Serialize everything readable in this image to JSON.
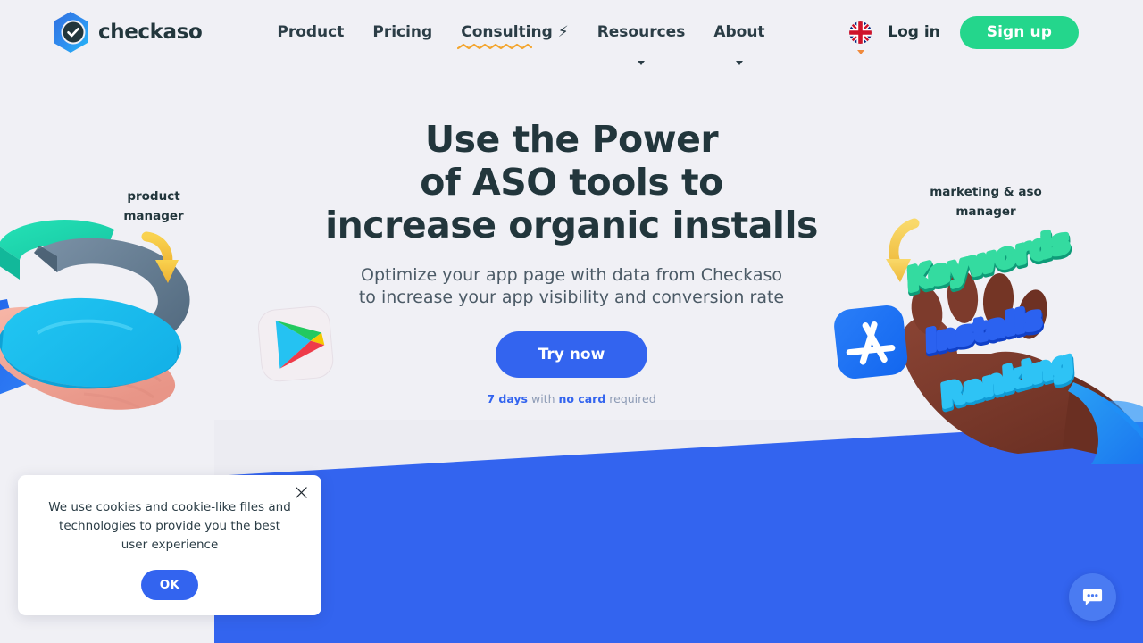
{
  "brand": {
    "name": "checkaso",
    "logo_icon": "checkaso-hexagon-check-logo",
    "accent_blue": "#3364ef",
    "accent_green": "#24d68c",
    "page_bg": "#f0f0f5",
    "heading_color": "#22363c"
  },
  "nav": {
    "items": [
      {
        "label": "Product",
        "icon": "",
        "has_caret": false,
        "active": false
      },
      {
        "label": "Pricing",
        "icon": "",
        "has_caret": false,
        "active": false
      },
      {
        "label": "Consulting",
        "icon": "lightning-bolt-icon",
        "bolt": "⚡",
        "has_caret": false,
        "active": true
      },
      {
        "label": "Resources",
        "icon": "chevron-down-icon",
        "has_caret": true,
        "active": false
      },
      {
        "label": "About",
        "icon": "chevron-down-icon",
        "has_caret": true,
        "active": false
      }
    ],
    "underline_color": "#f3a52e"
  },
  "header_right": {
    "language_icon": "uk-flag-icon",
    "language_caret_color": "#f08a3c",
    "login_label": "Log in",
    "signup_label": "Sign up"
  },
  "hero": {
    "title_lines": [
      "Use the Power",
      "of ASO tools to",
      "increase organic installs"
    ],
    "subtitle_lines": [
      "Optimize your app page with data from Checkaso",
      "to increase your app visibility and conversion rate"
    ],
    "cta_label": "Try now",
    "trial": {
      "days": "7 days",
      "with": "with",
      "card": "no card",
      "required": "required"
    }
  },
  "illustrations": {
    "left": {
      "label_lines": [
        "product",
        "manager"
      ],
      "icon": "hand-holding-donut-chart-3d-illustration"
    },
    "right": {
      "label_lines": [
        "marketing & aso",
        "manager"
      ],
      "icon": "hand-holding-aso-words-3d-illustration",
      "words": [
        "Keywords",
        "Installs",
        "Ranking"
      ]
    },
    "store_icons": [
      {
        "name": "google-play-icon"
      },
      {
        "name": "app-store-icon"
      }
    ]
  },
  "cookie_banner": {
    "text": "We use cookies and cookie-like files and technologies to provide you the best user experience",
    "ok_label": "OK",
    "close_icon": "close-icon"
  },
  "chat_widget": {
    "icon": "chat-bubble-icon",
    "color": "#4a7bf2"
  },
  "sections": {
    "blue_band_color": "#3364ef"
  }
}
